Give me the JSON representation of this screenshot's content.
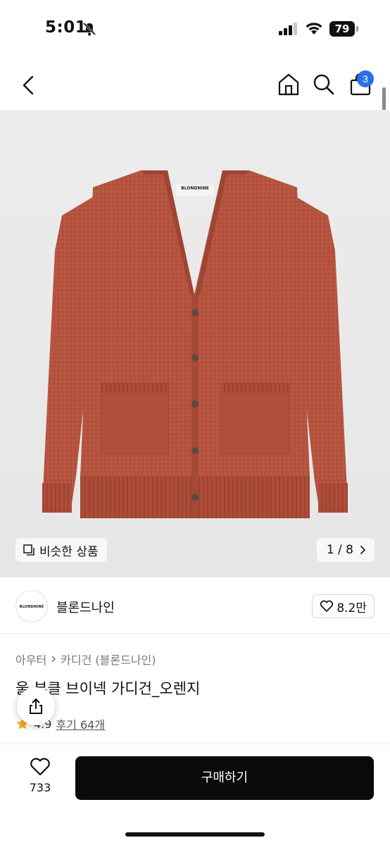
{
  "status_bar": {
    "time": "5:01",
    "battery": "79"
  },
  "nav": {
    "cart_count": "3"
  },
  "product_image": {
    "label_text": "BLONDNINE",
    "similar_label": "비슷한 상품",
    "page_counter": "1 / 8",
    "garment_color": "#b5533e"
  },
  "brand": {
    "logo_text": "BLONDNINE",
    "name": "블론드나인",
    "likes": "8.2만"
  },
  "breadcrumb": {
    "level1": "아우터",
    "level2": "카디건 (블론드나인)"
  },
  "product": {
    "title": "울 부클 브이넥 가디건_오렌지"
  },
  "rating": {
    "value": "4.9",
    "reviews": "후기 64개"
  },
  "bottom": {
    "like_count": "733",
    "buy_label": "구매하기"
  },
  "colors": {
    "accent_badge": "#2b6fe6",
    "buy_button": "#0a0a0a",
    "star": "#f5a623"
  }
}
